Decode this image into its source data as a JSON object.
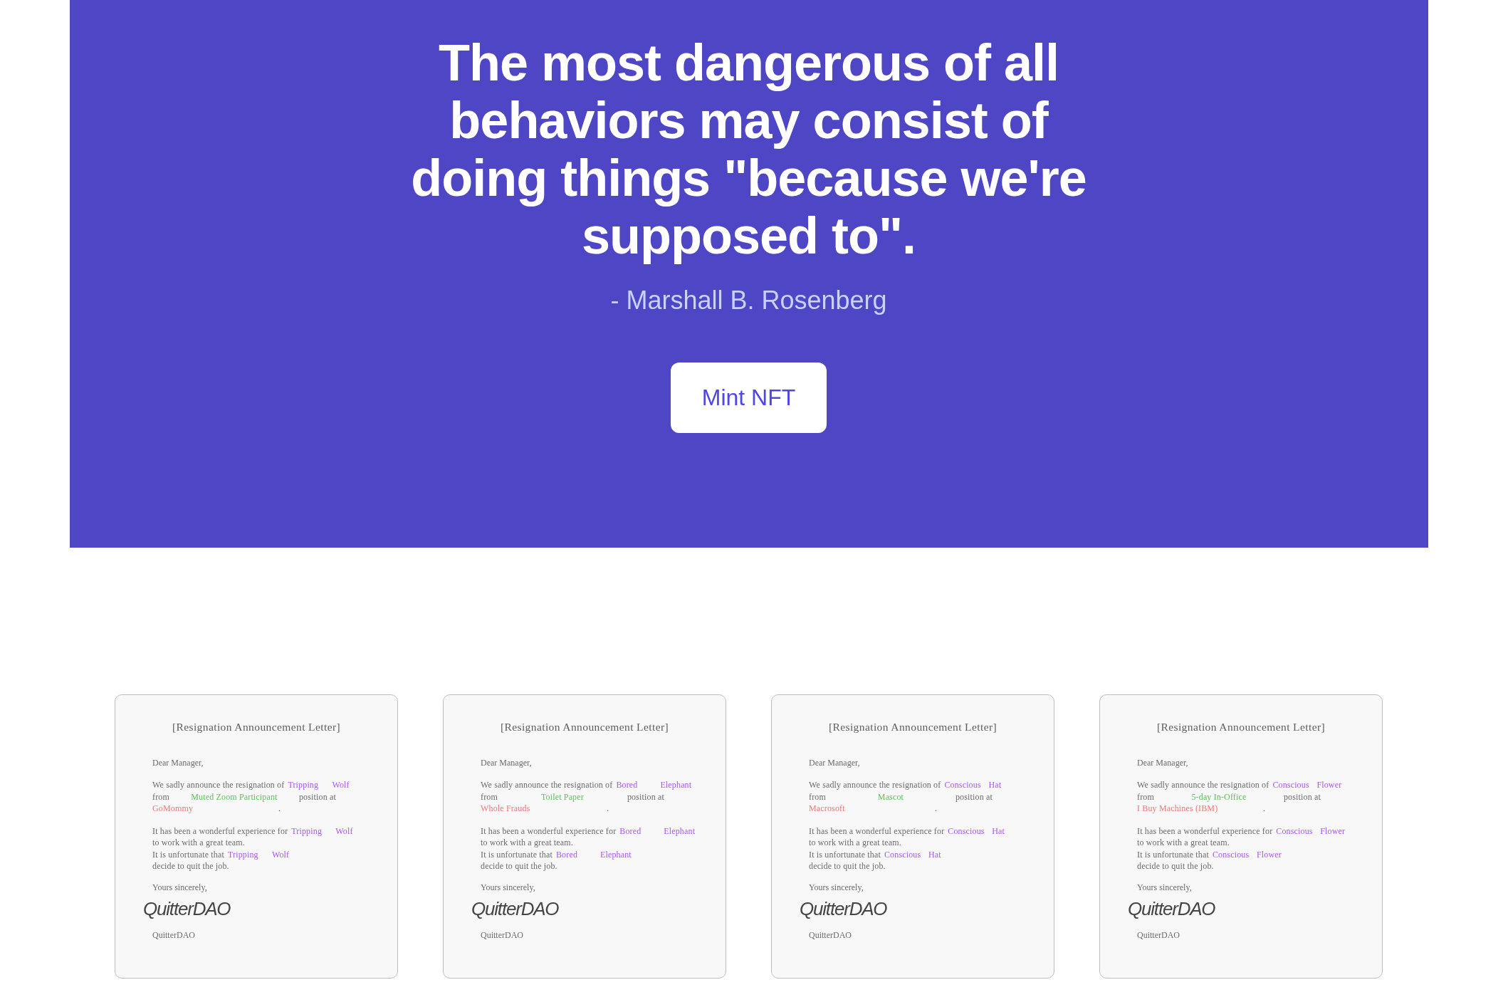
{
  "hero": {
    "quote": "The most dangerous of all behaviors may consist of doing things \"because we're supposed to\".",
    "author": "- Marshall B. Rosenberg",
    "button": "Mint NFT"
  },
  "letters": [
    {
      "title": "[Resignation Announcement Letter]",
      "greeting": "Dear Manager,",
      "paragraphs": [
        {
          "lines": [
            [
              {
                "kind": "text",
                "text": "We sadly announce the resignation of"
              },
              {
                "kind": "first_name",
                "text": "Tripping"
              },
              {
                "kind": "last_name",
                "text": "Wolf"
              }
            ],
            [
              {
                "kind": "text",
                "text": "from"
              },
              {
                "kind": "role",
                "text": "Muted Zoom Participant"
              },
              {
                "kind": "text",
                "text": "position at"
              }
            ],
            [
              {
                "kind": "company",
                "text": "GoMommy"
              },
              {
                "kind": "text",
                "text": "."
              }
            ]
          ]
        },
        {
          "lines": [
            [
              {
                "kind": "text",
                "text": "It has been a wonderful experience for"
              },
              {
                "kind": "first_name",
                "text": "Tripping"
              },
              {
                "kind": "last_name",
                "text": "Wolf"
              }
            ],
            [
              {
                "kind": "text",
                "text": "to work with a great team."
              }
            ],
            [
              {
                "kind": "text",
                "text": "It is unfortunate that"
              },
              {
                "kind": "first_name",
                "text": "Tripping"
              },
              {
                "kind": "last_name",
                "text": "Wolf"
              }
            ],
            [
              {
                "kind": "text",
                "text": "decide to quit the job."
              }
            ]
          ]
        }
      ],
      "closing": "Yours sincerely,",
      "signature": "QuitterDAO",
      "signer": "QuitterDAO"
    },
    {
      "title": "[Resignation Announcement Letter]",
      "greeting": "Dear Manager,",
      "paragraphs": [
        {
          "lines": [
            [
              {
                "kind": "text",
                "text": "We sadly announce the resignation of"
              },
              {
                "kind": "first_name",
                "text": "Bored"
              },
              {
                "kind": "last_name",
                "text": "Elephant"
              }
            ],
            [
              {
                "kind": "text",
                "text": "from"
              },
              {
                "kind": "role",
                "text": "Toilet Paper"
              },
              {
                "kind": "text",
                "text": "position at"
              }
            ],
            [
              {
                "kind": "company",
                "text": "Whole Frauds"
              },
              {
                "kind": "text",
                "text": "."
              }
            ]
          ]
        },
        {
          "lines": [
            [
              {
                "kind": "text",
                "text": "It has been a wonderful experience for"
              },
              {
                "kind": "first_name",
                "text": "Bored"
              },
              {
                "kind": "last_name",
                "text": "Elephant"
              }
            ],
            [
              {
                "kind": "text",
                "text": "to work with a great team."
              }
            ],
            [
              {
                "kind": "text",
                "text": "It is unfortunate that"
              },
              {
                "kind": "first_name",
                "text": "Bored"
              },
              {
                "kind": "last_name",
                "text": "Elephant"
              }
            ],
            [
              {
                "kind": "text",
                "text": "decide to quit the job."
              }
            ]
          ]
        }
      ],
      "closing": "Yours sincerely,",
      "signature": "QuitterDAO",
      "signer": "QuitterDAO"
    },
    {
      "title": "[Resignation Announcement Letter]",
      "greeting": "Dear Manager,",
      "paragraphs": [
        {
          "lines": [
            [
              {
                "kind": "text",
                "text": "We sadly announce the resignation of"
              },
              {
                "kind": "first_name",
                "text": "Conscious"
              },
              {
                "kind": "last_name",
                "text": "Hat"
              }
            ],
            [
              {
                "kind": "text",
                "text": "from"
              },
              {
                "kind": "role",
                "text": "Mascot"
              },
              {
                "kind": "text",
                "text": "position at"
              }
            ],
            [
              {
                "kind": "company",
                "text": "Macrosoft"
              },
              {
                "kind": "text",
                "text": "."
              }
            ]
          ]
        },
        {
          "lines": [
            [
              {
                "kind": "text",
                "text": "It has been a wonderful experience for"
              },
              {
                "kind": "first_name",
                "text": "Conscious"
              },
              {
                "kind": "last_name",
                "text": "Hat"
              }
            ],
            [
              {
                "kind": "text",
                "text": "to work with a great team."
              }
            ],
            [
              {
                "kind": "text",
                "text": "It is unfortunate that"
              },
              {
                "kind": "first_name",
                "text": "Conscious"
              },
              {
                "kind": "last_name",
                "text": "Hat"
              }
            ],
            [
              {
                "kind": "text",
                "text": "decide to quit the job."
              }
            ]
          ]
        }
      ],
      "closing": "Yours sincerely,",
      "signature": "QuitterDAO",
      "signer": "QuitterDAO"
    },
    {
      "title": "[Resignation Announcement Letter]",
      "greeting": "Dear Manager,",
      "paragraphs": [
        {
          "lines": [
            [
              {
                "kind": "text",
                "text": "We sadly announce the resignation of"
              },
              {
                "kind": "first_name",
                "text": "Conscious"
              },
              {
                "kind": "last_name",
                "text": "Flower"
              }
            ],
            [
              {
                "kind": "text",
                "text": "from"
              },
              {
                "kind": "role",
                "text": "5-day In-Office"
              },
              {
                "kind": "text",
                "text": "position at"
              }
            ],
            [
              {
                "kind": "company",
                "text": "I Buy Machines (IBM)"
              },
              {
                "kind": "text",
                "text": "."
              }
            ]
          ]
        },
        {
          "lines": [
            [
              {
                "kind": "text",
                "text": "It has been a wonderful experience for"
              },
              {
                "kind": "first_name",
                "text": "Conscious"
              },
              {
                "kind": "last_name",
                "text": "Flower"
              }
            ],
            [
              {
                "kind": "text",
                "text": "to work with a great team."
              }
            ],
            [
              {
                "kind": "text",
                "text": "It is unfortunate that"
              },
              {
                "kind": "first_name",
                "text": "Conscious"
              },
              {
                "kind": "last_name",
                "text": "Flower"
              }
            ],
            [
              {
                "kind": "text",
                "text": "decide to quit the job."
              }
            ]
          ]
        }
      ],
      "closing": "Yours sincerely,",
      "signature": "QuitterDAO",
      "signer": "QuitterDAO"
    }
  ]
}
